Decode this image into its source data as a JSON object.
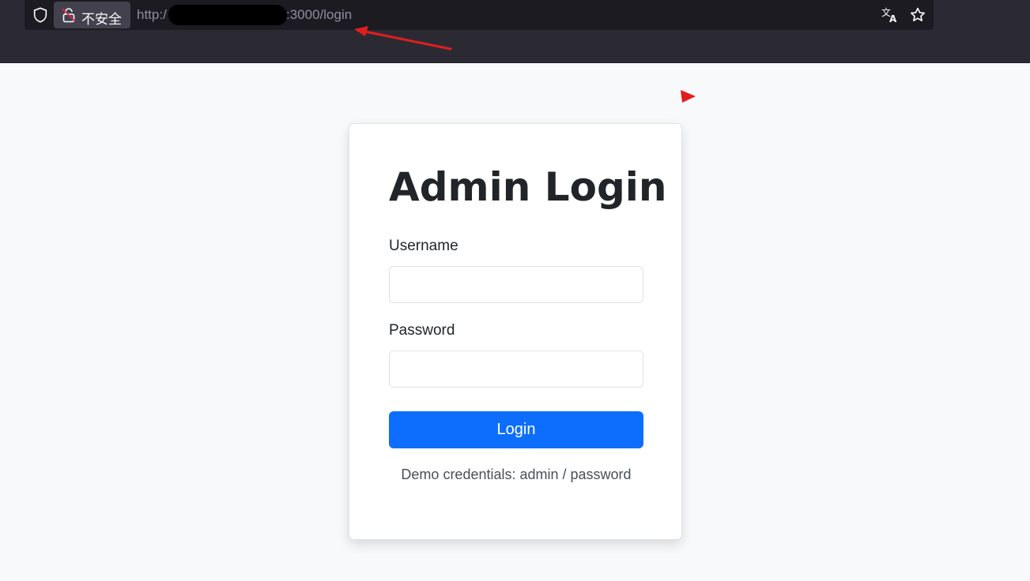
{
  "browser": {
    "security_label": "不安全",
    "url_prefix": "http:/",
    "url_suffix": ":3000/login",
    "icons": {
      "shield": "shield-icon",
      "lock": "insecure-lock-icon",
      "translate": "translate-icon",
      "bookmark": "star-icon"
    }
  },
  "login": {
    "title": "Admin Login",
    "username_label": "Username",
    "username_value": "",
    "password_label": "Password",
    "password_value": "",
    "submit_label": "Login",
    "demo_note": "Demo credentials: admin / password"
  },
  "colors": {
    "chrome_background": "#2b2a33",
    "url_bar_background": "#1c1b22",
    "page_background": "#f8f9fa",
    "primary_button": "#0d6efd",
    "annotation": "#e01e1e"
  }
}
